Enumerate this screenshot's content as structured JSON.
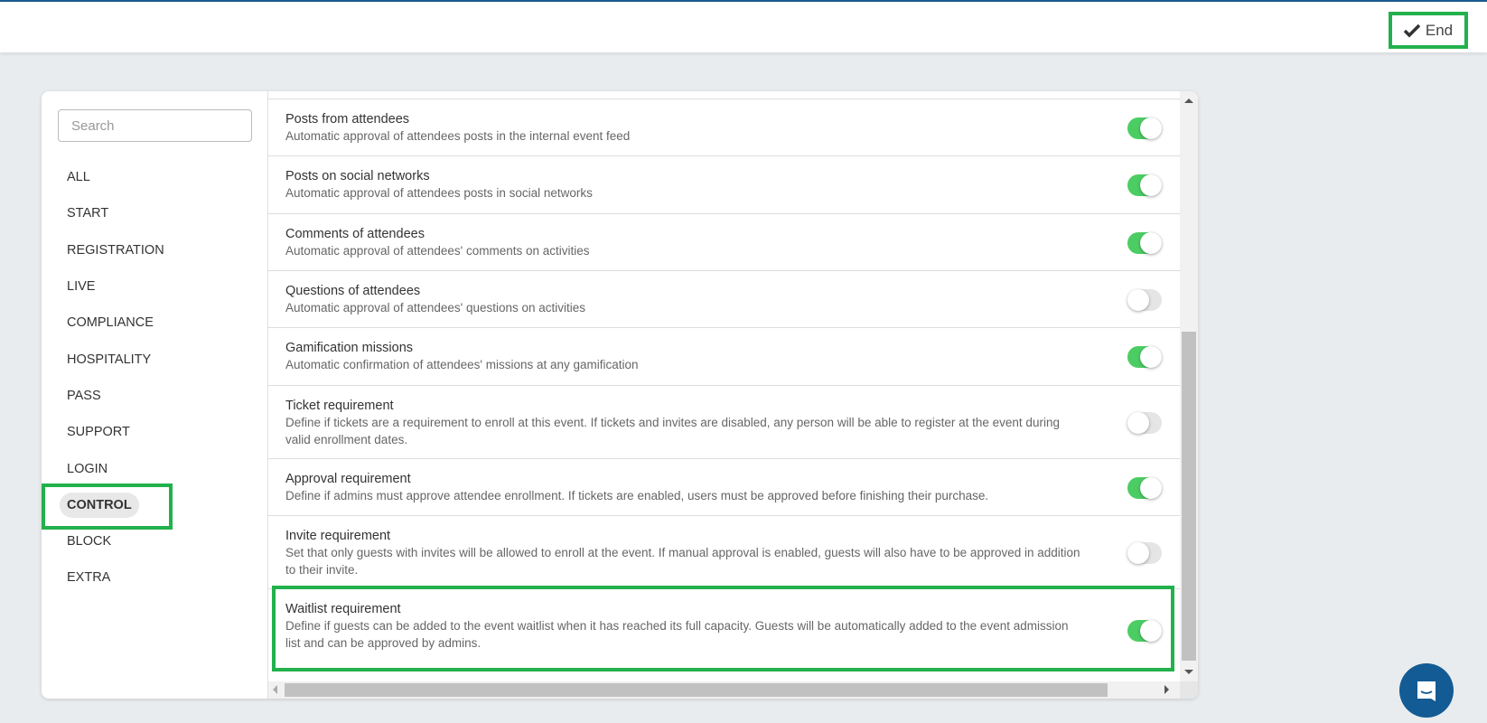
{
  "topbar": {
    "end_label": "End",
    "end_icon": "check-icon"
  },
  "sidebar": {
    "search_placeholder": "Search",
    "items": [
      {
        "label": "ALL",
        "active": false
      },
      {
        "label": "START",
        "active": false
      },
      {
        "label": "REGISTRATION",
        "active": false
      },
      {
        "label": "LIVE",
        "active": false
      },
      {
        "label": "COMPLIANCE",
        "active": false
      },
      {
        "label": "HOSPITALITY",
        "active": false
      },
      {
        "label": "PASS",
        "active": false
      },
      {
        "label": "SUPPORT",
        "active": false
      },
      {
        "label": "LOGIN",
        "active": false
      },
      {
        "label": "CONTROL",
        "active": true
      },
      {
        "label": "BLOCK",
        "active": false
      },
      {
        "label": "EXTRA",
        "active": false
      }
    ]
  },
  "settings": [
    {
      "title": "Posts from attendees",
      "description": "Automatic approval of attendees posts in the internal event feed",
      "enabled": true
    },
    {
      "title": "Posts on social networks",
      "description": "Automatic approval of attendees posts in social networks",
      "enabled": true
    },
    {
      "title": "Comments of attendees",
      "description": "Automatic approval of attendees' comments on activities",
      "enabled": true
    },
    {
      "title": "Questions of attendees",
      "description": "Automatic approval of attendees' questions on activities",
      "enabled": false
    },
    {
      "title": "Gamification missions",
      "description": "Automatic confirmation of attendees' missions at any gamification",
      "enabled": true
    },
    {
      "title": "Ticket requirement",
      "description": "Define if tickets are a requirement to enroll at this event. If tickets and invites are disabled, any person will be able to register at the event during valid enrollment dates.",
      "enabled": false
    },
    {
      "title": "Approval requirement",
      "description": "Define if admins must approve attendee enrollment. If tickets are enabled, users must be approved before finishing their purchase.",
      "enabled": true
    },
    {
      "title": "Invite requirement",
      "description": "Set that only guests with invites will be allowed to enroll at the event. If manual approval is enabled, guests will also have to be approved in addition to their invite.",
      "enabled": false
    },
    {
      "title": "Waitlist requirement",
      "description": "Define if guests can be added to the event waitlist when it has reached its full capacity. Guests will be automatically added to the event admission list and can be approved by admins.",
      "enabled": true
    }
  ],
  "colors": {
    "accent": "#22b14c",
    "toggle_on": "#4ccd64",
    "brand": "#135b94"
  },
  "chat": {
    "icon": "chat-icon"
  }
}
